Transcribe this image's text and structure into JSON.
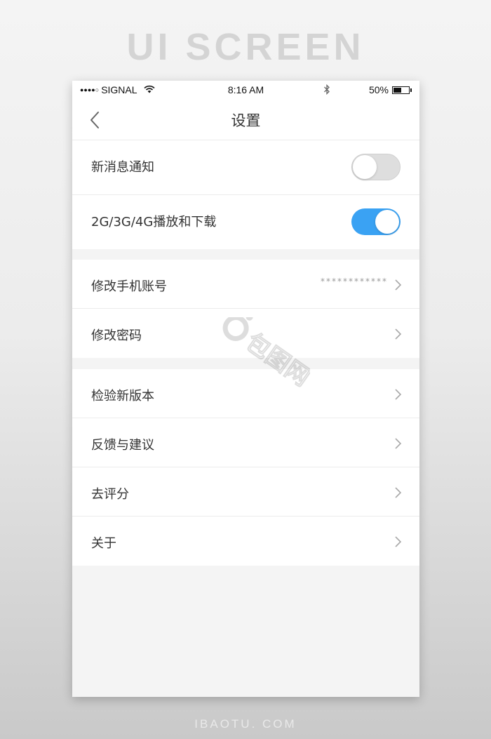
{
  "poster": {
    "title": "UI SCREEN",
    "footer": "IBAOTU. COM"
  },
  "status_bar": {
    "signal_dots": "●●●●○",
    "carrier": "SIGNAL",
    "time": "8:16 AM",
    "battery_percent": "50%",
    "battery_level": 0.5
  },
  "nav": {
    "title": "设置",
    "back_icon": "chevron-left-icon"
  },
  "settings": {
    "notifications": {
      "label": "新消息通知",
      "enabled": false
    },
    "mobile_data_playback": {
      "label": "2G/3G/4G播放和下载",
      "enabled": true
    },
    "change_phone": {
      "label": "修改手机账号",
      "value": "************"
    },
    "change_password": {
      "label": "修改密码"
    },
    "check_version": {
      "label": "检验新版本"
    },
    "feedback": {
      "label": "反馈与建议"
    },
    "rate": {
      "label": "去评分"
    },
    "about": {
      "label": "关于"
    }
  },
  "watermark": {
    "text": "包图网"
  },
  "colors": {
    "accent": "#3aa2f3",
    "toggle_off": "#dedede",
    "background": "#f4f4f4",
    "text_primary": "#333333",
    "text_secondary": "#999999"
  }
}
